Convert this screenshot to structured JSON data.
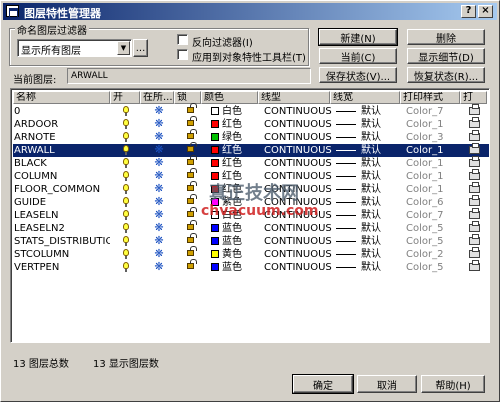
{
  "window": {
    "title": "图层特性管理器",
    "help_btn": "?",
    "close_btn": "×"
  },
  "filter": {
    "group_label": "命名图层过滤器",
    "selected": "显示所有图层",
    "more_btn": "...",
    "invert_label": "反向过滤器(I)",
    "apply_toolbar_label": "应用到对象特性工具栏(T)"
  },
  "buttons": {
    "new": "新建(N)",
    "delete": "删除",
    "current": "当前(C)",
    "show_details": "显示细节(D)",
    "save_state": "保存状态(V)...",
    "restore_state": "恢复状态(R)...",
    "ok": "确定",
    "cancel": "取消",
    "help": "帮助(H)"
  },
  "current_layer": {
    "label": "当前图层:",
    "value": "ARWALL"
  },
  "columns": [
    "名称",
    "开",
    "在所...",
    "锁",
    "颜色",
    "线型",
    "线宽",
    "打印样式",
    "打"
  ],
  "lineweight_default": "默认",
  "layers": [
    {
      "name": "0",
      "color_name": "白色",
      "color_hex": "#ffffff",
      "linetype": "CONTINUOUS",
      "lineweight": "默认",
      "plot_style": "Color_7",
      "selected": false
    },
    {
      "name": "ARDOOR",
      "color_name": "红色",
      "color_hex": "#ff0000",
      "linetype": "CONTINUOUS",
      "lineweight": "默认",
      "plot_style": "Color_1",
      "selected": false
    },
    {
      "name": "ARNOTE",
      "color_name": "绿色",
      "color_hex": "#00c000",
      "linetype": "CONTINUOUS",
      "lineweight": "默认",
      "plot_style": "Color_3",
      "selected": false
    },
    {
      "name": "ARWALL",
      "color_name": "红色",
      "color_hex": "#ff0000",
      "linetype": "CONTINUOUS",
      "lineweight": "默认",
      "plot_style": "Color_1",
      "selected": true
    },
    {
      "name": "BLACK",
      "color_name": "红色",
      "color_hex": "#ff0000",
      "linetype": "CONTINUOUS",
      "lineweight": "默认",
      "plot_style": "Color_1",
      "selected": false
    },
    {
      "name": "COLUMN",
      "color_name": "红色",
      "color_hex": "#ff0000",
      "linetype": "CONTINUOUS",
      "lineweight": "默认",
      "plot_style": "Color_1",
      "selected": false
    },
    {
      "name": "FLOOR_COMMON",
      "color_name": "红色",
      "color_hex": "#ff0000",
      "linetype": "CONTINUOUS",
      "lineweight": "默认",
      "plot_style": "Color_1",
      "selected": false
    },
    {
      "name": "GUIDE",
      "color_name": "紫色",
      "color_hex": "#ff00ff",
      "linetype": "CONTINUOUS",
      "lineweight": "默认",
      "plot_style": "Color_6",
      "selected": false
    },
    {
      "name": "LEASELN",
      "color_name": "白色",
      "color_hex": "#ffffff",
      "linetype": "CONTINUOUS",
      "lineweight": "默认",
      "plot_style": "Color_7",
      "selected": false
    },
    {
      "name": "LEASELN2",
      "color_name": "蓝色",
      "color_hex": "#0000ff",
      "linetype": "CONTINUOUS",
      "lineweight": "默认",
      "plot_style": "Color_5",
      "selected": false
    },
    {
      "name": "STATS_DISTRIBUTION",
      "color_name": "蓝色",
      "color_hex": "#0000ff",
      "linetype": "CONTINUOUS",
      "lineweight": "默认",
      "plot_style": "Color_5",
      "selected": false
    },
    {
      "name": "STCOLUMN",
      "color_name": "黄色",
      "color_hex": "#ffff00",
      "linetype": "CONTINUOUS",
      "lineweight": "默认",
      "plot_style": "Color_2",
      "selected": false
    },
    {
      "name": "VERTPEN",
      "color_name": "蓝色",
      "color_hex": "#0000ff",
      "linetype": "CONTINUOUS",
      "lineweight": "默认",
      "plot_style": "Color_5",
      "selected": false
    }
  ],
  "status": {
    "total": "13 图层总数",
    "displayed": "13 显示图层数"
  },
  "watermark": {
    "cn": "真正技术网",
    "url": "chvacuum.com"
  }
}
